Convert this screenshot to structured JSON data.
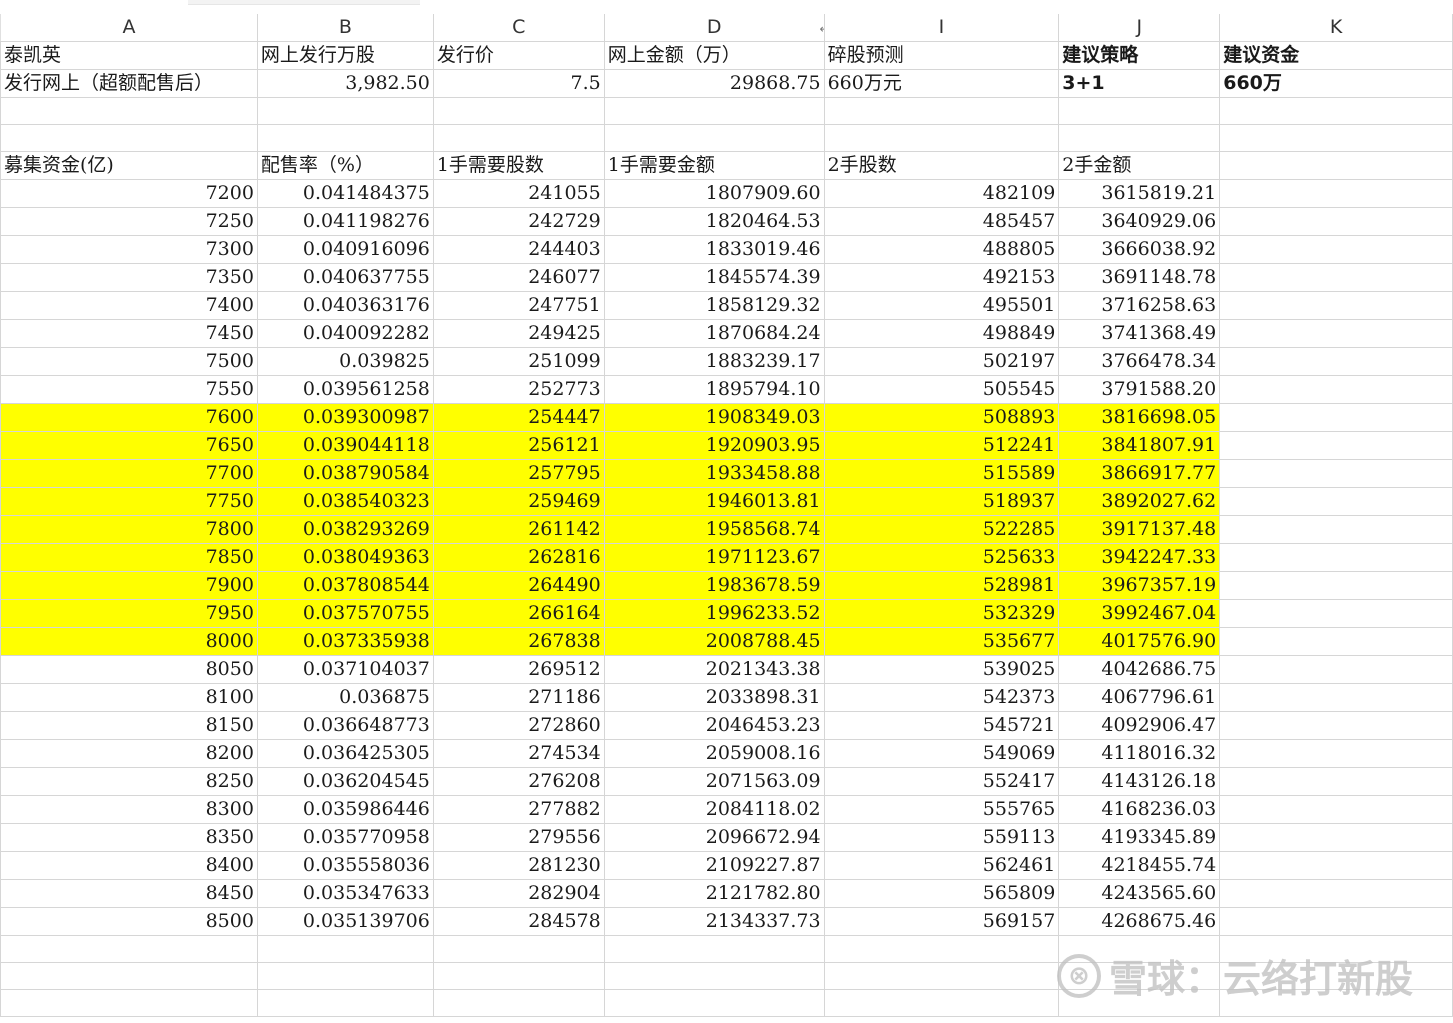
{
  "columns": [
    "A",
    "B",
    "C",
    "D",
    "I",
    "J",
    "K"
  ],
  "header_row1": {
    "a": "泰凯英",
    "b": "网上发行万股",
    "c": "发行价",
    "d": "网上金额（万）",
    "i": "碎股预测",
    "j": "建议策略",
    "k": "建议资金"
  },
  "header_row2": {
    "a": "发行网上（超额配售后）",
    "b": "3,982.50",
    "c": "7.5",
    "d": "29868.75",
    "i": "660万元",
    "j": "3+1",
    "k": "660万"
  },
  "table_header": {
    "a": "募集资金(亿)",
    "b": "配售率（%）",
    "c": "1手需要股数",
    "d": "1手需要金额",
    "i": "2手股数",
    "j": "2手金额"
  },
  "rows": [
    [
      "7200",
      "0.041484375",
      "241055",
      "1807909.60",
      "482109",
      "3615819.21"
    ],
    [
      "7250",
      "0.041198276",
      "242729",
      "1820464.53",
      "485457",
      "3640929.06"
    ],
    [
      "7300",
      "0.040916096",
      "244403",
      "1833019.46",
      "488805",
      "3666038.92"
    ],
    [
      "7350",
      "0.040637755",
      "246077",
      "1845574.39",
      "492153",
      "3691148.78"
    ],
    [
      "7400",
      "0.040363176",
      "247751",
      "1858129.32",
      "495501",
      "3716258.63"
    ],
    [
      "7450",
      "0.040092282",
      "249425",
      "1870684.24",
      "498849",
      "3741368.49"
    ],
    [
      "7500",
      "0.039825",
      "251099",
      "1883239.17",
      "502197",
      "3766478.34"
    ],
    [
      "7550",
      "0.039561258",
      "252773",
      "1895794.10",
      "505545",
      "3791588.20"
    ],
    [
      "7600",
      "0.039300987",
      "254447",
      "1908349.03",
      "508893",
      "3816698.05"
    ],
    [
      "7650",
      "0.039044118",
      "256121",
      "1920903.95",
      "512241",
      "3841807.91"
    ],
    [
      "7700",
      "0.038790584",
      "257795",
      "1933458.88",
      "515589",
      "3866917.77"
    ],
    [
      "7750",
      "0.038540323",
      "259469",
      "1946013.81",
      "518937",
      "3892027.62"
    ],
    [
      "7800",
      "0.038293269",
      "261142",
      "1958568.74",
      "522285",
      "3917137.48"
    ],
    [
      "7850",
      "0.038049363",
      "262816",
      "1971123.67",
      "525633",
      "3942247.33"
    ],
    [
      "7900",
      "0.037808544",
      "264490",
      "1983678.59",
      "528981",
      "3967357.19"
    ],
    [
      "7950",
      "0.037570755",
      "266164",
      "1996233.52",
      "532329",
      "3992467.04"
    ],
    [
      "8000",
      "0.037335938",
      "267838",
      "2008788.45",
      "535677",
      "4017576.90"
    ],
    [
      "8050",
      "0.037104037",
      "269512",
      "2021343.38",
      "539025",
      "4042686.75"
    ],
    [
      "8100",
      "0.036875",
      "271186",
      "2033898.31",
      "542373",
      "4067796.61"
    ],
    [
      "8150",
      "0.036648773",
      "272860",
      "2046453.23",
      "545721",
      "4092906.47"
    ],
    [
      "8200",
      "0.036425305",
      "274534",
      "2059008.16",
      "549069",
      "4118016.32"
    ],
    [
      "8250",
      "0.036204545",
      "276208",
      "2071563.09",
      "552417",
      "4143126.18"
    ],
    [
      "8300",
      "0.035986446",
      "277882",
      "2084118.02",
      "555765",
      "4168236.03"
    ],
    [
      "8350",
      "0.035770958",
      "279556",
      "2096672.94",
      "559113",
      "4193345.89"
    ],
    [
      "8400",
      "0.035558036",
      "281230",
      "2109227.87",
      "562461",
      "4218455.74"
    ],
    [
      "8450",
      "0.035347633",
      "282904",
      "2121782.80",
      "565809",
      "4243565.60"
    ],
    [
      "8500",
      "0.035139706",
      "284578",
      "2134337.73",
      "569157",
      "4268675.46"
    ]
  ],
  "highlight_rows": [
    8,
    9,
    10,
    11,
    12,
    13,
    14,
    15,
    16
  ],
  "highlight_color": "#ffff00",
  "watermark": {
    "logo": "雪球-logo-icon",
    "text": "雪球：云络打新股"
  }
}
